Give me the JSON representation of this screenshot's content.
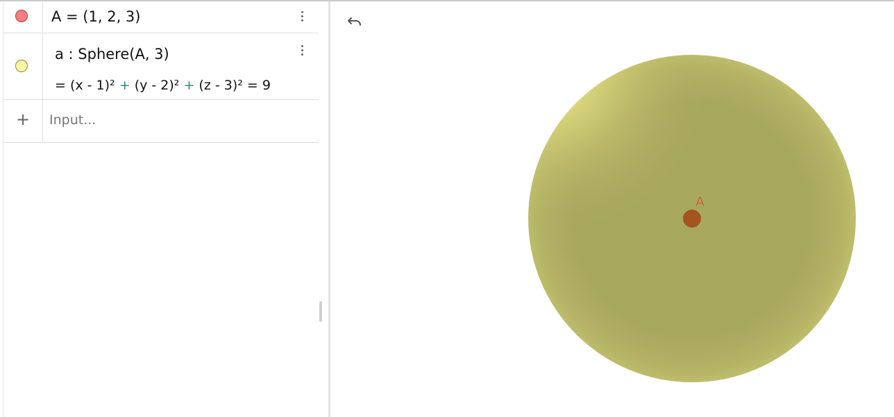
{
  "algebra": {
    "items": [
      {
        "marker_color": "#f08080",
        "definition": "A = (1, 2, 3)"
      },
      {
        "marker_color": "#f7f7a8",
        "definition": "a : Sphere(A, 3)",
        "output_parts": [
          "= (x - 1)²",
          "+",
          "(y - 2)²",
          "+",
          "(z - 3)² = 9"
        ]
      }
    ],
    "input": {
      "add_icon": "+",
      "placeholder": "Input..."
    }
  },
  "graphics": {
    "undo_icon": "undo-icon",
    "point_label": "A",
    "sphere_color": "#a8a75e",
    "point_color": "#a45420"
  }
}
